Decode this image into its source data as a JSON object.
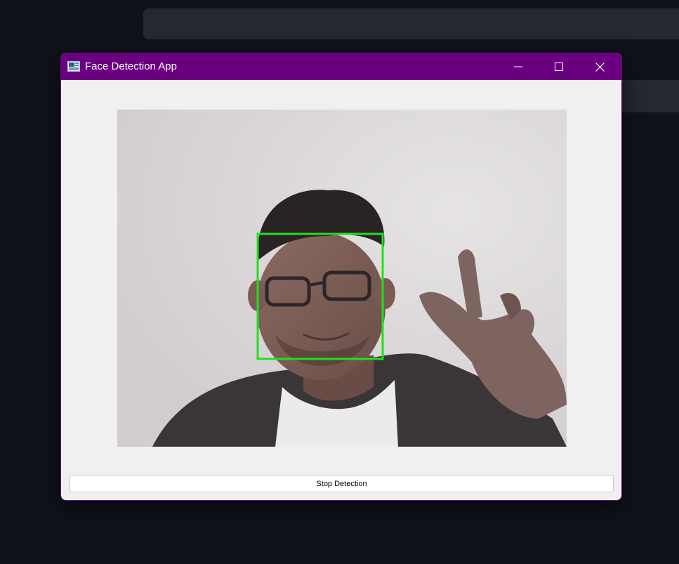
{
  "window": {
    "title": "Face Detection App",
    "accent_color": "#6a0080",
    "icon": "app-window-icon",
    "controls": {
      "minimize_icon": "minimize-icon",
      "maximize_icon": "maximize-icon",
      "close_icon": "close-icon"
    }
  },
  "video": {
    "detection_box_color": "#22e01a"
  },
  "controls": {
    "stop_button_label": "Stop Detection"
  }
}
